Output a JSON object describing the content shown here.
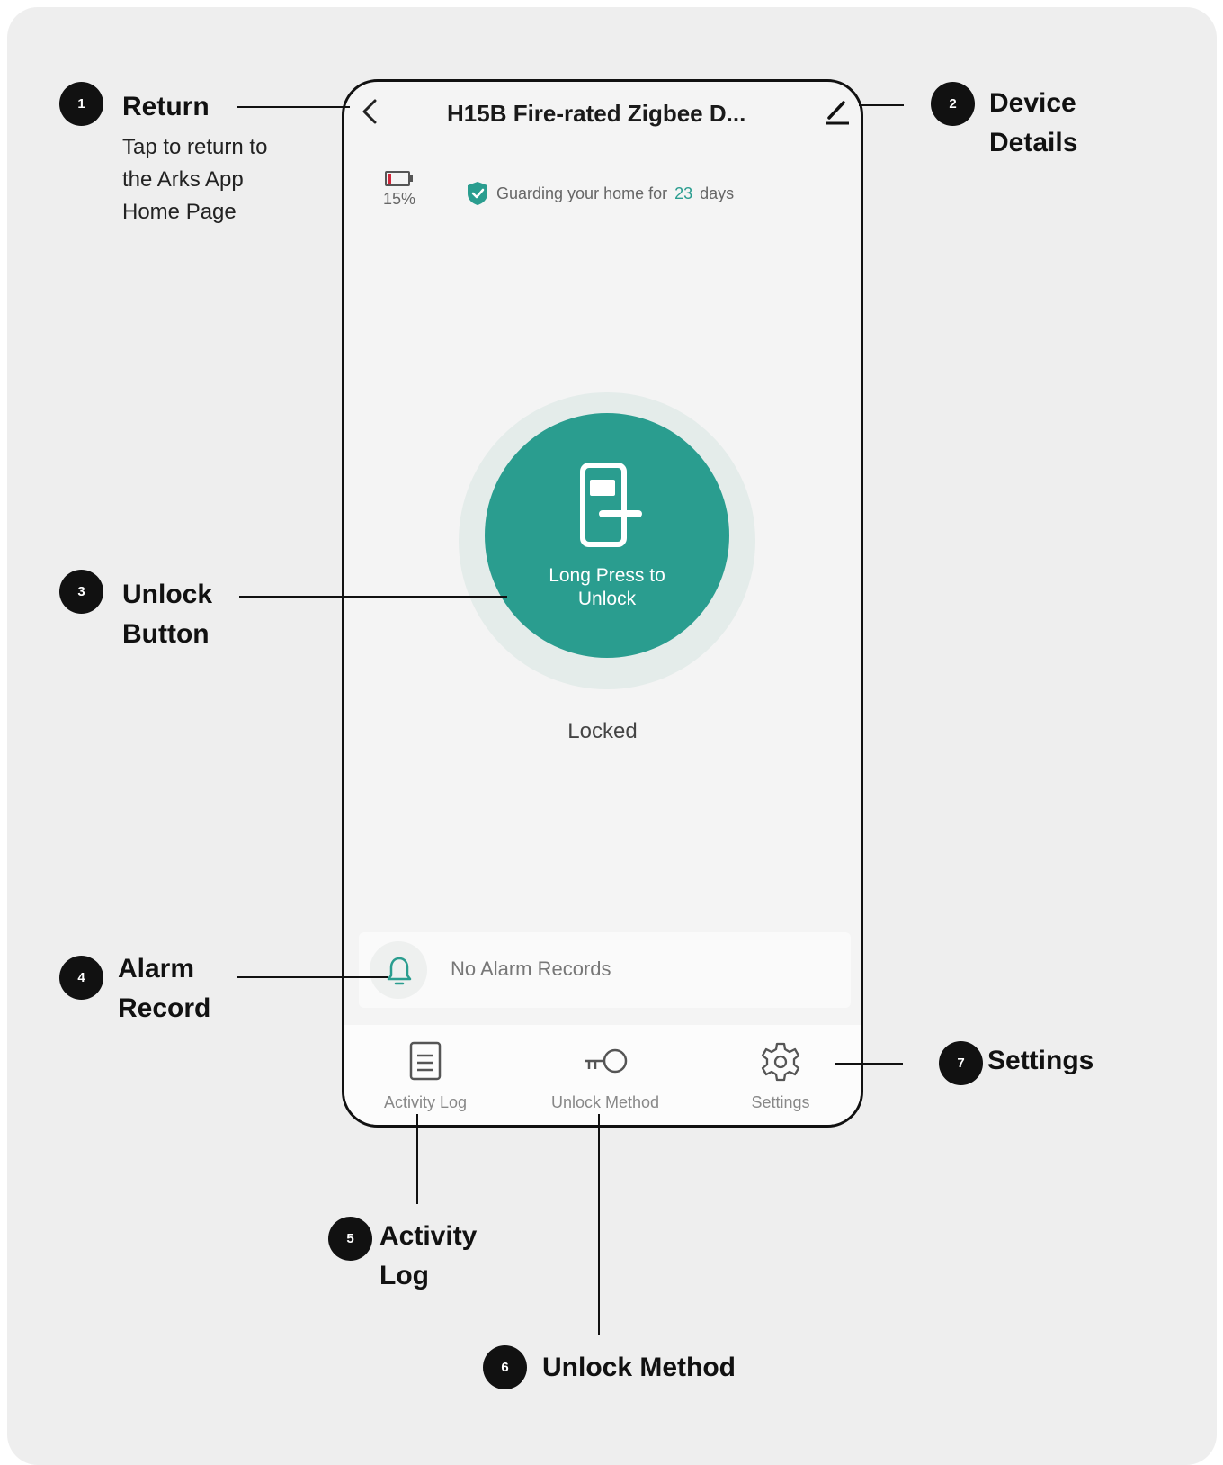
{
  "phone": {
    "title": "H15B Fire-rated Zigbee D...",
    "battery_percent": "15%",
    "guard": {
      "prefix": "Guarding your home for",
      "days": "23",
      "suffix": "days"
    },
    "unlock_label": "Long Press to\nUnlock",
    "lock_status": "Locked",
    "alarm_text": "No Alarm Records",
    "nav": [
      {
        "label": "Activity Log",
        "icon": "document-icon"
      },
      {
        "label": "Unlock Method",
        "icon": "key-icon"
      },
      {
        "label": "Settings",
        "icon": "gear-icon"
      }
    ],
    "colors": {
      "accent": "#2a9d8f",
      "battery_low": "#d0263a"
    }
  },
  "callouts": [
    {
      "number": "1",
      "title": "Return",
      "description": "Tap to return to\nthe Arks App\nHome Page"
    },
    {
      "number": "2",
      "title": "Device\nDetails"
    },
    {
      "number": "3",
      "title": "Unlock\nButton"
    },
    {
      "number": "4",
      "title": "Alarm\nRecord"
    },
    {
      "number": "5",
      "title": "Activity\nLog"
    },
    {
      "number": "6",
      "title": "Unlock Method"
    },
    {
      "number": "7",
      "title": "Settings"
    }
  ]
}
